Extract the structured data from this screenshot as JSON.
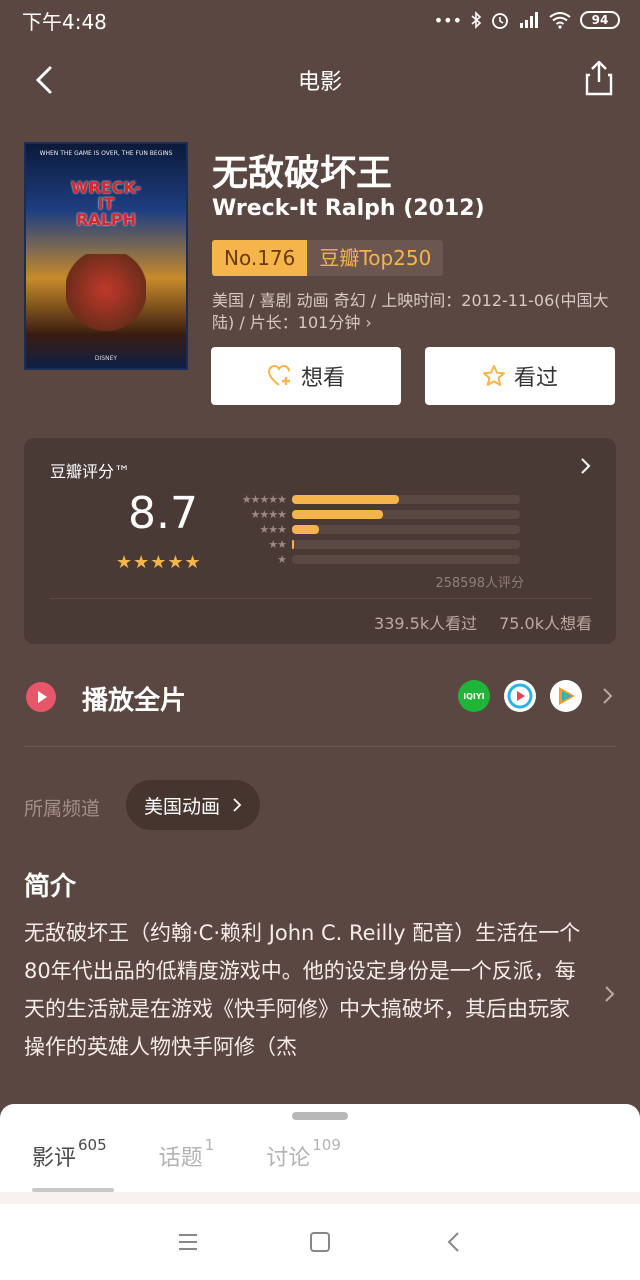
{
  "status_bar": {
    "time": "下午4:48",
    "battery": "94"
  },
  "nav": {
    "title": "电影"
  },
  "movie": {
    "title": "无敌破坏王",
    "original_title": "Wreck-It Ralph (2012)",
    "rank_no": "No.176",
    "rank_list": "豆瓣Top250",
    "meta": "美国 / 喜剧 动画 奇幻 / 上映时间：2012-11-06(中国大陆) / 片长：101分钟 ›",
    "poster_top_text": "WHEN THE GAME IS OVER, THE FUN BEGINS",
    "poster_logo": "WRECK-IT RALPH",
    "poster_bottom_text": "DISNEY"
  },
  "actions": {
    "want_label": "想看",
    "seen_label": "看过"
  },
  "rating": {
    "title": "豆瓣评分™",
    "score": "8.7",
    "stars_display": "★★★★★",
    "star_rows": [
      "★★★★★",
      "★★★★",
      "★★★",
      "★★",
      "★"
    ],
    "distribution": [
      0.47,
      0.4,
      0.12,
      0.01,
      0.0
    ],
    "count": "258598人评分",
    "seen_count": "339.5k人看过",
    "want_count": "75.0k人想看"
  },
  "play": {
    "label": "播放全片",
    "platforms": [
      "iQIYI",
      "Youku",
      "Tencent"
    ]
  },
  "channel": {
    "label": "所属频道",
    "value": "美国动画"
  },
  "intro": {
    "title": "简介",
    "text": "无敌破坏王（约翰·C·赖利 John C. Reilly 配音）生活在一个80年代出品的低精度游戏中。他的设定身份是一个反派，每天的生活就是在游戏《快手阿修》中大搞破坏，其后由玩家操作的英雄人物快手阿修（杰"
  },
  "tabs": [
    {
      "label": "影评",
      "count": "605"
    },
    {
      "label": "话题",
      "count": "1"
    },
    {
      "label": "讨论",
      "count": "109"
    }
  ],
  "colors": {
    "background": "#5b4741",
    "accent": "#f5b54a",
    "card": "#4a3a35"
  }
}
